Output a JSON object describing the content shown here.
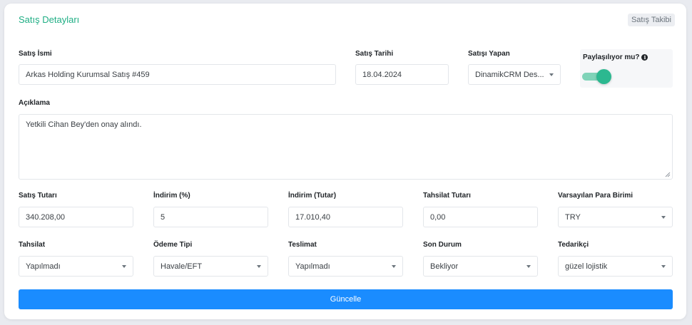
{
  "card": {
    "title": "Satış Detayları",
    "badge": "Satış Takibi"
  },
  "row1": {
    "sale_name": {
      "label": "Satış İsmi",
      "value": "Arkas Holding Kurumsal Satış #459"
    },
    "sale_date": {
      "label": "Satış Tarihi",
      "value": "18.04.2024"
    },
    "seller": {
      "label": "Satışı Yapan",
      "value": "DinamikCRM Des..."
    },
    "shared": {
      "label": "Paylaşılıyor mu?",
      "on": true
    }
  },
  "description": {
    "label": "Açıklama",
    "value": "Yetkili Cihan Bey'den onay alındı."
  },
  "row3": {
    "amount": {
      "label": "Satış Tutarı",
      "value": "340.208,00"
    },
    "discount_pct": {
      "label": "İndirim (%)",
      "value": "5"
    },
    "discount_amt": {
      "label": "İndirim (Tutar)",
      "value": "17.010,40"
    },
    "collection_amt": {
      "label": "Tahsilat Tutarı",
      "value": "0,00"
    },
    "currency": {
      "label": "Varsayılan Para Birimi",
      "value": "TRY"
    }
  },
  "row4": {
    "collection": {
      "label": "Tahsilat",
      "value": "Yapılmadı"
    },
    "payment_type": {
      "label": "Ödeme Tipi",
      "value": "Havale/EFT"
    },
    "delivery": {
      "label": "Teslimat",
      "value": "Yapılmadı"
    },
    "status": {
      "label": "Son Durum",
      "value": "Bekliyor"
    },
    "supplier": {
      "label": "Tedarikçi",
      "value": "güzel lojistik"
    }
  },
  "actions": {
    "update_label": "Güncelle"
  },
  "colors": {
    "accent": "#1fae84",
    "primary": "#1a8cff",
    "toggle_on": "#2cb890"
  }
}
